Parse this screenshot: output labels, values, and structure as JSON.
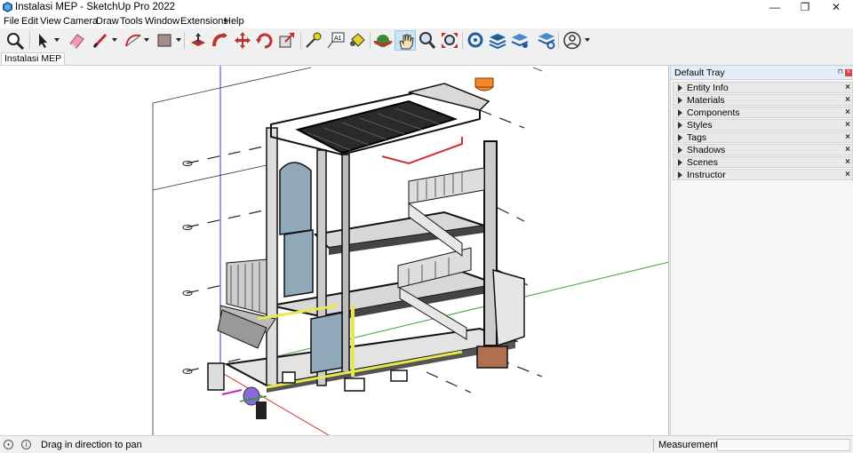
{
  "window": {
    "title": "Instalasi MEP - SketchUp Pro 2022",
    "minimize": "—",
    "restore": "❐",
    "close": "✕"
  },
  "menu": [
    "File",
    "Edit",
    "View",
    "Camera",
    "Draw",
    "Tools",
    "Window",
    "Extensions",
    "Help"
  ],
  "tabs": [
    {
      "label": "Instalasi MEP"
    }
  ],
  "tray": {
    "title": "Default Tray",
    "pin": "⊓",
    "close": "×",
    "panels": [
      "Entity Info",
      "Materials",
      "Components",
      "Styles",
      "Tags",
      "Shadows",
      "Scenes",
      "Instructor"
    ],
    "panel_close": "×"
  },
  "status": {
    "hint": "Drag in direction to pan",
    "measurements_label": "Measurements",
    "measurements_value": ""
  },
  "colors": {
    "axis_red": "#d03030",
    "axis_green": "#36a636",
    "axis_blue": "#3b3bd1",
    "pipe_yellow": "#e8e84a",
    "tank_orange": "#f08a2a"
  }
}
